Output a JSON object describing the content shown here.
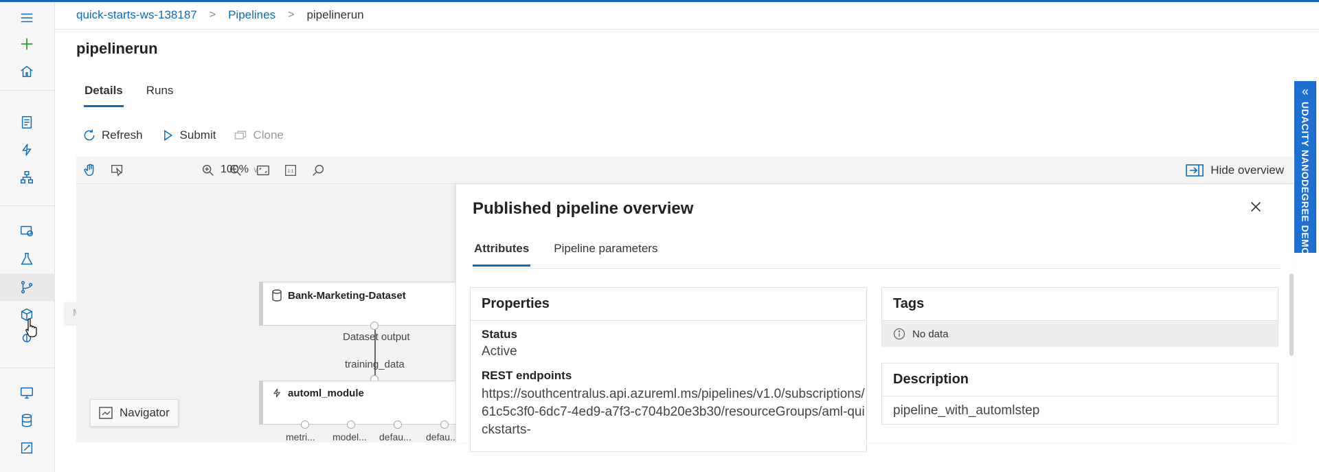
{
  "breadcrumb": {
    "workspace": "quick-starts-ws-138187",
    "pipelines": "Pipelines",
    "current": "pipelinerun"
  },
  "page": {
    "title": "pipelinerun"
  },
  "tabs": [
    {
      "label": "Details",
      "active": true
    },
    {
      "label": "Runs",
      "active": false
    }
  ],
  "actions": {
    "refresh": "Refresh",
    "submit": "Submit",
    "clone": "Clone"
  },
  "toolbar": {
    "zoom": "100%",
    "hide_overview": "Hide overview"
  },
  "nav": {
    "tooltip": "Models"
  },
  "canvas": {
    "dataset_node": "Bank-Marketing-Dataset",
    "dataset_output": "Dataset output",
    "training_data": "training_data",
    "module_node": "automl_module",
    "outputs": [
      "metri...",
      "model...",
      "defau...",
      "defau..."
    ],
    "navigator": "Navigator"
  },
  "panel": {
    "title": "Published pipeline overview",
    "tabs": [
      {
        "label": "Attributes",
        "active": true
      },
      {
        "label": "Pipeline parameters",
        "active": false
      }
    ],
    "properties": {
      "heading": "Properties",
      "status_label": "Status",
      "status_value": "Active",
      "rest_label": "REST endpoints",
      "rest_value": "https://southcentralus.api.azureml.ms/pipelines/v1.0/subscriptions/61c5c3f0-6dc7-4ed9-a7f3-c704b20e3b30/resourceGroups/aml-quickstarts-"
    },
    "tags": {
      "heading": "Tags",
      "empty": "No data"
    },
    "description": {
      "heading": "Description",
      "value": "pipeline_with_automlstep"
    }
  },
  "banner": {
    "text": "UDACITY NANODEGREE DEMO"
  },
  "colors": {
    "accent": "#0f6cbd",
    "banner": "#1d6fd1"
  }
}
